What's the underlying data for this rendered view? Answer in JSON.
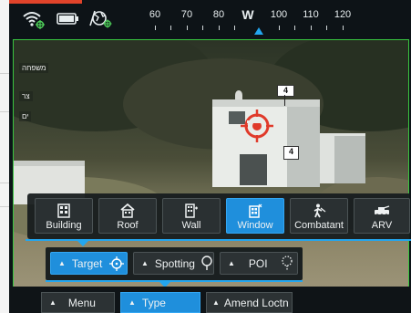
{
  "compass": {
    "ticks": [
      "60",
      "70",
      "80",
      "W",
      "100",
      "110",
      "120"
    ]
  },
  "sidebar": {
    "labels": [
      "משפחה",
      "צר",
      "ים"
    ]
  },
  "markers": {
    "top_tag": "4",
    "bottom_tag": "4"
  },
  "categories": [
    {
      "label": "Building",
      "icon": "building-icon"
    },
    {
      "label": "Roof",
      "icon": "roof-icon"
    },
    {
      "label": "Wall",
      "icon": "wall-icon"
    },
    {
      "label": "Window",
      "icon": "window-icon"
    },
    {
      "label": "Combatant",
      "icon": "combatant-icon"
    },
    {
      "label": "ARV",
      "icon": "arv-icon"
    }
  ],
  "active_category": "Window",
  "types": [
    {
      "label": "Target",
      "icon": "crosshair-icon"
    },
    {
      "label": "Spotting",
      "icon": "spotting-pin-icon"
    },
    {
      "label": "POI",
      "icon": "poi-icon"
    }
  ],
  "active_type": "Target",
  "bottom": {
    "menu": "Menu",
    "type": "Type",
    "amend": "Amend Loctn"
  },
  "colors": {
    "accent": "#1f8fdc",
    "frame": "#39c53f",
    "reticle": "#e03a2a",
    "top_accent": "#e0432a"
  }
}
